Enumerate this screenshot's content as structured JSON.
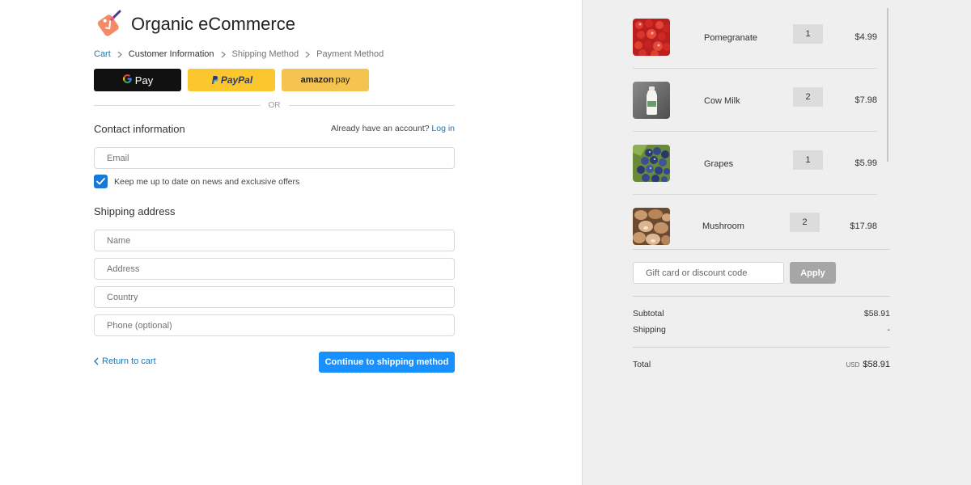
{
  "header": {
    "title": "Organic eCommerce",
    "logo_icon": "shopping-tag-icon",
    "accent": "#f28b66"
  },
  "breadcrumb": {
    "items": [
      {
        "label": "Cart",
        "state": "link"
      },
      {
        "label": "Customer Information",
        "state": "current"
      },
      {
        "label": "Shipping Method",
        "state": "upcoming"
      },
      {
        "label": "Payment Method",
        "state": "upcoming"
      }
    ]
  },
  "express": {
    "gpay": "Pay",
    "paypal": "PayPal",
    "amazon": "amazon",
    "amazon_pay": "pay",
    "or": "OR"
  },
  "contact": {
    "title": "Contact information",
    "account_prompt": "Already have an account?",
    "login": "Log in",
    "email_placeholder": "Email",
    "newsletter": "Keep me up to date on news and exclusive offers",
    "newsletter_checked": true
  },
  "shipping": {
    "title": "Shipping address",
    "name_placeholder": "Name",
    "address_placeholder": "Address",
    "country_placeholder": "Country",
    "phone_placeholder": "Phone (optional)"
  },
  "actions": {
    "return": "Return to cart",
    "continue": "Continue to shipping method"
  },
  "cart": {
    "items": [
      {
        "name": "Pomegranate",
        "qty": "1",
        "price": "$4.99",
        "image": "pomegranate"
      },
      {
        "name": "Cow Milk",
        "qty": "2",
        "price": "$7.98",
        "image": "milk-bottle"
      },
      {
        "name": "Grapes",
        "qty": "1",
        "price": "$5.99",
        "image": "grapes"
      },
      {
        "name": "Mushroom",
        "qty": "2",
        "price": "$17.98",
        "image": "mushroom"
      }
    ],
    "discount_placeholder": "Gift card or discount code",
    "apply": "Apply",
    "subtotal_label": "Subtotal",
    "subtotal": "$58.91",
    "shipping_label": "Shipping",
    "shipping": "-",
    "total_label": "Total",
    "currency": "USD",
    "total": "$58.91"
  },
  "colors": {
    "link": "#1878b9",
    "primary_button": "#1990ff",
    "checkbox": "#1878d8",
    "apply_button": "#a6a6a6",
    "sidebar_bg": "#efefef"
  }
}
